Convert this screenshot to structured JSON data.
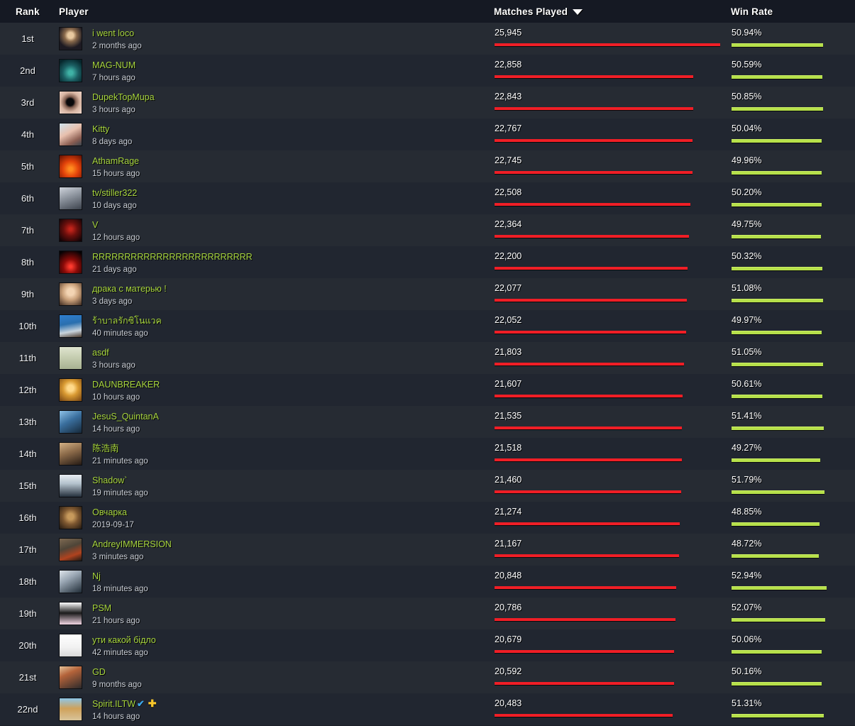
{
  "header": {
    "rank_label": "Rank",
    "player_label": "Player",
    "matches_label": "Matches Played",
    "winrate_label": "Win Rate",
    "sort_icon": "chevron-down-icon",
    "sorted_column": "Matches Played"
  },
  "colors": {
    "page_background": "#1b1f27",
    "header_background": "#151923",
    "row_background": "#262b33",
    "row_background_alt": "#212630",
    "player_name": "#a8d63f",
    "matches_bar": "#f01e26",
    "winrate_bar": "#b6e04a",
    "verified_badge": "#3ea6e8",
    "plus_badge": "#f7c52b"
  },
  "chart_data": {
    "type": "bar",
    "title": "Matches Played / Win Rate leaderboard",
    "categories": [
      "i went loco",
      "MAG-NUM",
      "DupekTopMupa",
      "Kitty",
      "AthamRage",
      "tv/stiller322",
      "V",
      "RRRRRRRRRRRRRRRRRRRRRRRRR",
      "драка с матерью !",
      "ร้าบาลรักซิโนแวค",
      "asdf",
      "DAUNBREAKER",
      "JesuS_QuintanA",
      "陈浩南",
      "Shadow`",
      "Овчарка",
      "AndreyIMMERSION",
      "Nj",
      "PSM",
      "ути какой бідло",
      "GD",
      "Spirit.ILTW"
    ],
    "series": [
      {
        "name": "Matches Played",
        "color": "#f01e26",
        "values": [
          25945,
          22858,
          22843,
          22767,
          22745,
          22508,
          22364,
          22200,
          22077,
          22052,
          21803,
          21607,
          21535,
          21518,
          21460,
          21274,
          21167,
          20848,
          20786,
          20679,
          20592,
          20483
        ]
      },
      {
        "name": "Win Rate",
        "color": "#b6e04a",
        "values": [
          50.94,
          50.59,
          50.85,
          50.04,
          49.96,
          50.2,
          49.75,
          50.32,
          51.08,
          49.97,
          51.05,
          50.61,
          51.41,
          49.27,
          51.79,
          48.85,
          48.72,
          52.94,
          52.07,
          50.06,
          50.16,
          51.31
        ]
      }
    ],
    "xlabel": "",
    "ylabel": "",
    "grid": false,
    "legend_position": "none"
  },
  "rows": [
    {
      "rank": "1st",
      "name": "i went loco",
      "date": "2 months ago",
      "matches": "25,945",
      "matches_bar_pct": 100.0,
      "winrate": "50.94%",
      "winrate_bar_pct": 96.4,
      "avatar": "avatar-i-went-loco",
      "avatar_class": "av1",
      "verified": false,
      "plus": false
    },
    {
      "rank": "2nd",
      "name": "MAG-NUM",
      "date": "7 hours ago",
      "matches": "22,858",
      "matches_bar_pct": 88.1,
      "winrate": "50.59%",
      "winrate_bar_pct": 95.8,
      "avatar": "avatar-mag-num",
      "avatar_class": "av2",
      "verified": false,
      "plus": false
    },
    {
      "rank": "3rd",
      "name": "DupekTopMupa",
      "date": "3 hours ago",
      "matches": "22,843",
      "matches_bar_pct": 88.0,
      "winrate": "50.85%",
      "winrate_bar_pct": 96.2,
      "avatar": "avatar-dupektopmupa",
      "avatar_class": "av3",
      "verified": false,
      "plus": false
    },
    {
      "rank": "4th",
      "name": "Kitty",
      "date": "8 days ago",
      "matches": "22,767",
      "matches_bar_pct": 87.8,
      "winrate": "50.04%",
      "winrate_bar_pct": 94.7,
      "avatar": "avatar-kitty",
      "avatar_class": "av4",
      "verified": false,
      "plus": false
    },
    {
      "rank": "5th",
      "name": "AthamRage",
      "date": "15 hours ago",
      "matches": "22,745",
      "matches_bar_pct": 87.7,
      "winrate": "49.96%",
      "winrate_bar_pct": 94.5,
      "avatar": "avatar-athamrage",
      "avatar_class": "av5",
      "verified": false,
      "plus": false
    },
    {
      "rank": "6th",
      "name": "tv/stiller322",
      "date": "10 days ago",
      "matches": "22,508",
      "matches_bar_pct": 86.8,
      "winrate": "50.20%",
      "winrate_bar_pct": 95.0,
      "avatar": "avatar-tv-stiller322",
      "avatar_class": "av6",
      "verified": false,
      "plus": false
    },
    {
      "rank": "7th",
      "name": "V",
      "date": "12 hours ago",
      "matches": "22,364",
      "matches_bar_pct": 86.2,
      "winrate": "49.75%",
      "winrate_bar_pct": 94.1,
      "avatar": "avatar-v",
      "avatar_class": "av7",
      "verified": false,
      "plus": false
    },
    {
      "rank": "8th",
      "name": "RRRRRRRRRRRRRRRRRRRRRRRRR",
      "date": "21 days ago",
      "matches": "22,200",
      "matches_bar_pct": 85.6,
      "winrate": "50.32%",
      "winrate_bar_pct": 95.2,
      "avatar": "avatar-rrrr",
      "avatar_class": "av8",
      "verified": false,
      "plus": false
    },
    {
      "rank": "9th",
      "name": "драка с матерью !",
      "date": "3 days ago",
      "matches": "22,077",
      "matches_bar_pct": 85.1,
      "winrate": "51.08%",
      "winrate_bar_pct": 96.6,
      "avatar": "avatar-draka",
      "avatar_class": "av9",
      "verified": false,
      "plus": false
    },
    {
      "rank": "10th",
      "name": "ร้าบาลรักซิโนแวค",
      "date": "40 minutes ago",
      "matches": "22,052",
      "matches_bar_pct": 85.0,
      "winrate": "49.97%",
      "winrate_bar_pct": 94.5,
      "avatar": "avatar-thai-player",
      "avatar_class": "av10",
      "verified": false,
      "plus": false
    },
    {
      "rank": "11th",
      "name": "asdf",
      "date": "3 hours ago",
      "matches": "21,803",
      "matches_bar_pct": 84.0,
      "winrate": "51.05%",
      "winrate_bar_pct": 96.6,
      "avatar": "avatar-asdf",
      "avatar_class": "av11",
      "verified": false,
      "plus": false
    },
    {
      "rank": "12th",
      "name": "DAUNBREAKER",
      "date": "10 hours ago",
      "matches": "21,607",
      "matches_bar_pct": 83.3,
      "winrate": "50.61%",
      "winrate_bar_pct": 95.7,
      "avatar": "avatar-daunbreaker",
      "avatar_class": "av12",
      "verified": false,
      "plus": false
    },
    {
      "rank": "13th",
      "name": "JesuS_QuintanA",
      "date": "14 hours ago",
      "matches": "21,535",
      "matches_bar_pct": 83.0,
      "winrate": "51.41%",
      "winrate_bar_pct": 97.2,
      "avatar": "avatar-jesus-quintana",
      "avatar_class": "av13",
      "verified": false,
      "plus": false
    },
    {
      "rank": "14th",
      "name": "陈浩南",
      "date": "21 minutes ago",
      "matches": "21,518",
      "matches_bar_pct": 82.9,
      "winrate": "49.27%",
      "winrate_bar_pct": 93.2,
      "avatar": "avatar-chen-hao-nan",
      "avatar_class": "av14",
      "verified": false,
      "plus": false
    },
    {
      "rank": "15th",
      "name": "Shadow`",
      "date": "19 minutes ago",
      "matches": "21,460",
      "matches_bar_pct": 82.7,
      "winrate": "51.79%",
      "winrate_bar_pct": 97.9,
      "avatar": "avatar-shadow",
      "avatar_class": "av15",
      "verified": false,
      "plus": false
    },
    {
      "rank": "16th",
      "name": "Овчарка",
      "date": "2019-09-17",
      "matches": "21,274",
      "matches_bar_pct": 82.0,
      "winrate": "48.85%",
      "winrate_bar_pct": 92.4,
      "avatar": "avatar-ovcharka",
      "avatar_class": "av16",
      "verified": false,
      "plus": false
    },
    {
      "rank": "17th",
      "name": "AndreyIMMERSION",
      "date": "3 minutes ago",
      "matches": "21,167",
      "matches_bar_pct": 81.6,
      "winrate": "48.72%",
      "winrate_bar_pct": 92.1,
      "avatar": "avatar-andreyimmersion",
      "avatar_class": "av17",
      "verified": false,
      "plus": false
    },
    {
      "rank": "18th",
      "name": "Nj",
      "date": "18 minutes ago",
      "matches": "20,848",
      "matches_bar_pct": 80.4,
      "winrate": "52.94%",
      "winrate_bar_pct": 100.0,
      "avatar": "avatar-nj",
      "avatar_class": "av18",
      "verified": false,
      "plus": false
    },
    {
      "rank": "19th",
      "name": "PSM",
      "date": "21 hours ago",
      "matches": "20,786",
      "matches_bar_pct": 80.1,
      "winrate": "52.07%",
      "winrate_bar_pct": 98.4,
      "avatar": "avatar-psm",
      "avatar_class": "av19",
      "verified": false,
      "plus": false
    },
    {
      "rank": "20th",
      "name": "ути какой бідло",
      "date": "42 minutes ago",
      "matches": "20,679",
      "matches_bar_pct": 79.7,
      "winrate": "50.06%",
      "winrate_bar_pct": 94.6,
      "avatar": "avatar-uti-kakoy",
      "avatar_class": "av20",
      "verified": false,
      "plus": false
    },
    {
      "rank": "21st",
      "name": "GD",
      "date": "9 months ago",
      "matches": "20,592",
      "matches_bar_pct": 79.4,
      "winrate": "50.16%",
      "winrate_bar_pct": 94.8,
      "avatar": "avatar-gd",
      "avatar_class": "av21",
      "verified": false,
      "plus": false
    },
    {
      "rank": "22nd",
      "name": "Spirit.ILTW",
      "date": "14 hours ago",
      "matches": "20,483",
      "matches_bar_pct": 79.0,
      "winrate": "51.31%",
      "winrate_bar_pct": 97.0,
      "avatar": "avatar-spirit-iltw",
      "avatar_class": "av22",
      "verified": true,
      "plus": true
    }
  ]
}
